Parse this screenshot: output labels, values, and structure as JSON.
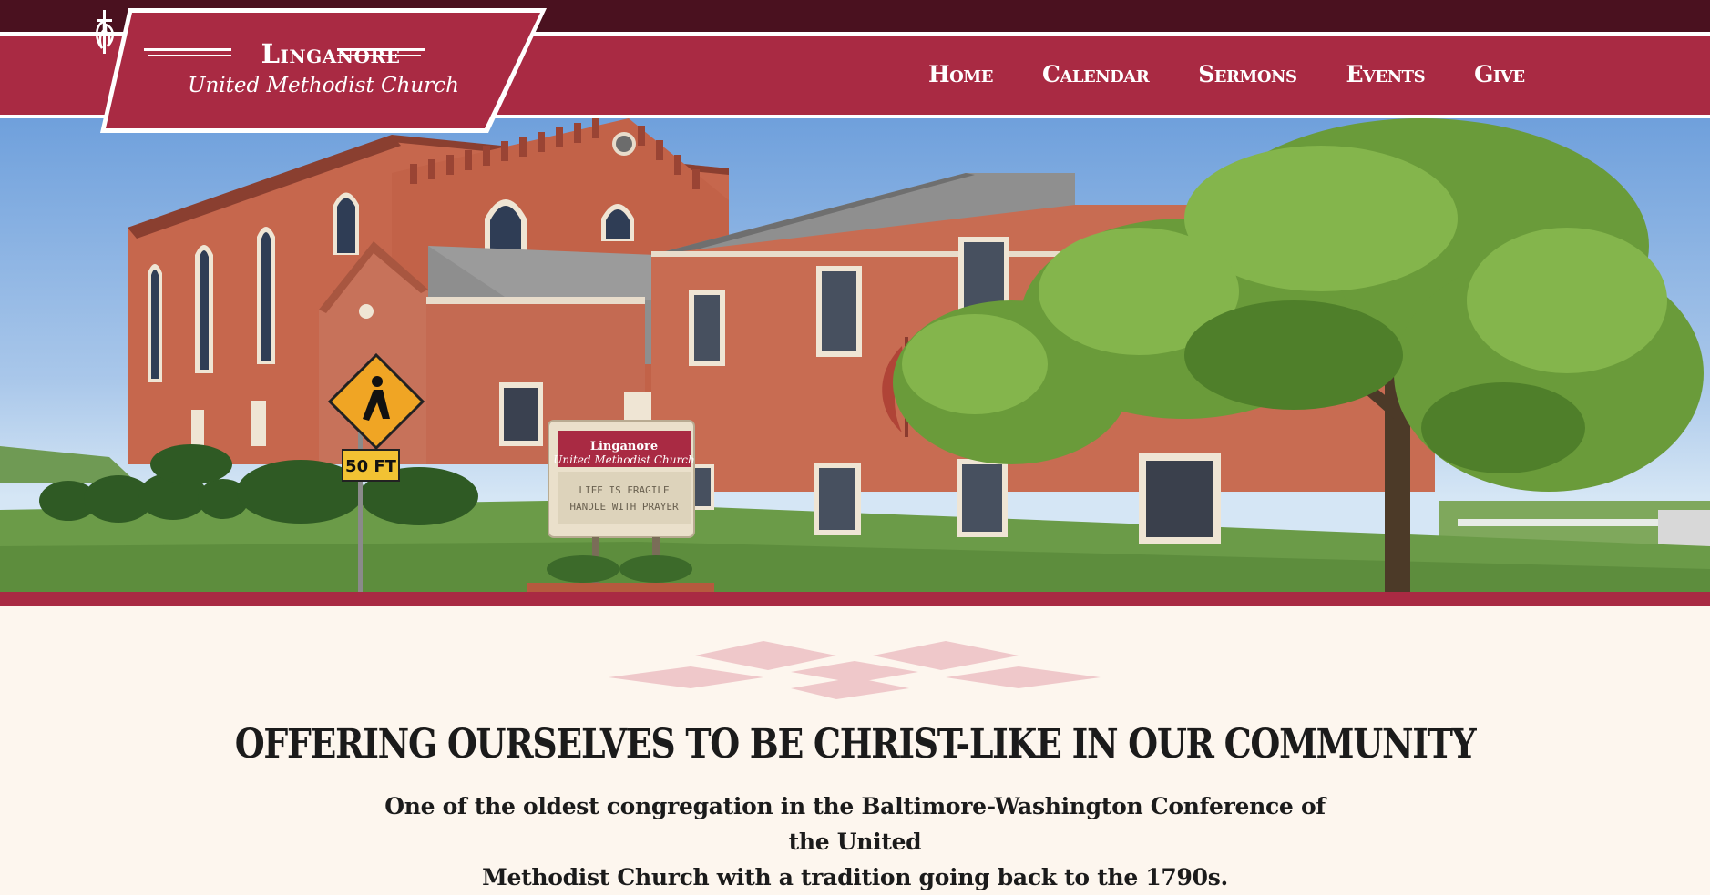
{
  "brand": {
    "name": "Linganore",
    "subtitle": "United Methodist Church",
    "cross_icon": "cross-and-flame-icon",
    "colors": {
      "primary": "#a92a43",
      "dark": "#4a111f",
      "cream": "#fdf6ee"
    }
  },
  "nav": {
    "items": [
      {
        "label": "Home"
      },
      {
        "label": "Calendar"
      },
      {
        "label": "Sermons"
      },
      {
        "label": "Events"
      },
      {
        "label": "Give"
      }
    ]
  },
  "hero": {
    "sign_title_1": "Linganore",
    "sign_title_2": "United Methodist Church",
    "sign_line_1": "LIFE IS FRAGILE",
    "sign_line_2": "HANDLE WITH PRAYER",
    "road_sign_text": "50 FT"
  },
  "intro": {
    "ornament_icon": "diamond-ornament-icon",
    "heading": "OFFERING OURSELVES TO BE CHRIST-LIKE IN OUR COMMUNITY",
    "text_line_1": "One of the oldest congregation in the Baltimore-Washington Conference of the United",
    "text_line_2": "Methodist Church with a tradition going back to the 1790s."
  }
}
